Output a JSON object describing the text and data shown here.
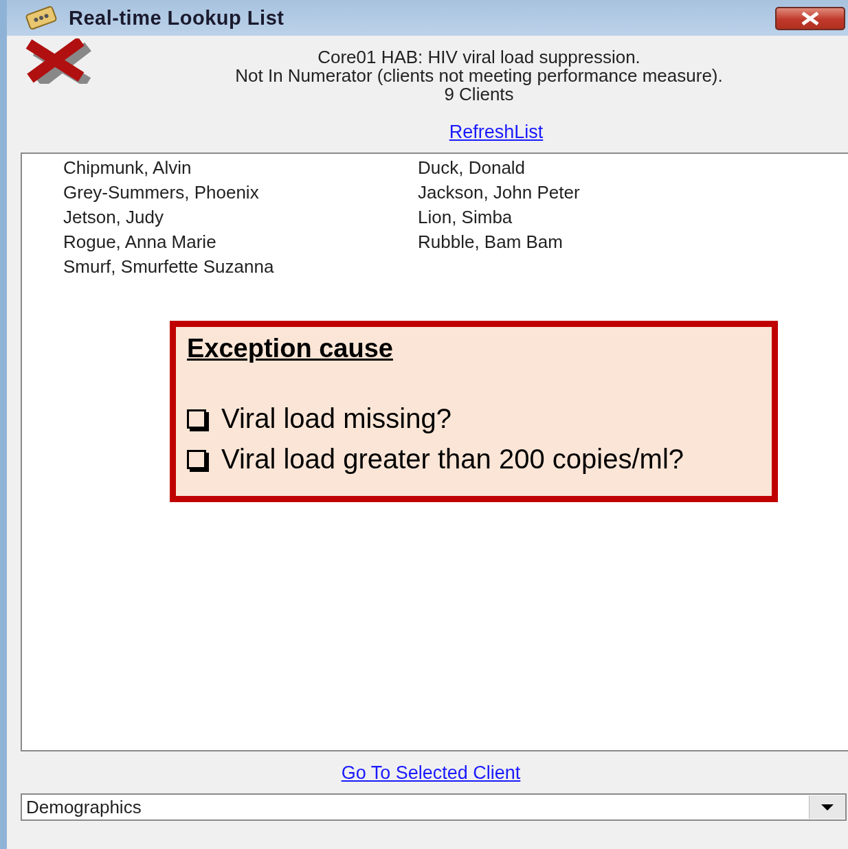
{
  "window": {
    "title": "Real-time Lookup List"
  },
  "header": {
    "lines": [
      "Core01 HAB: HIV viral load suppression.",
      "Not In Numerator (clients not meeting performance measure).",
      "9 Clients"
    ],
    "refresh_link": "RefreshList"
  },
  "clients": [
    "Chipmunk, Alvin",
    "Duck, Donald",
    "Grey-Summers, Phoenix",
    "Jackson, John Peter",
    "Jetson, Judy",
    "Lion, Simba",
    "Rogue, Anna Marie",
    "Rubble, Bam Bam",
    "Smurf, Smurfette Suzanna"
  ],
  "callout": {
    "title": "Exception cause",
    "items": [
      {
        "label": "Viral load missing?",
        "checked": false
      },
      {
        "label": "Viral load greater than 200 copies/ml?",
        "checked": false
      }
    ]
  },
  "footer": {
    "link": "Go To Selected Client",
    "dropdown": {
      "value": "Demographics"
    }
  }
}
